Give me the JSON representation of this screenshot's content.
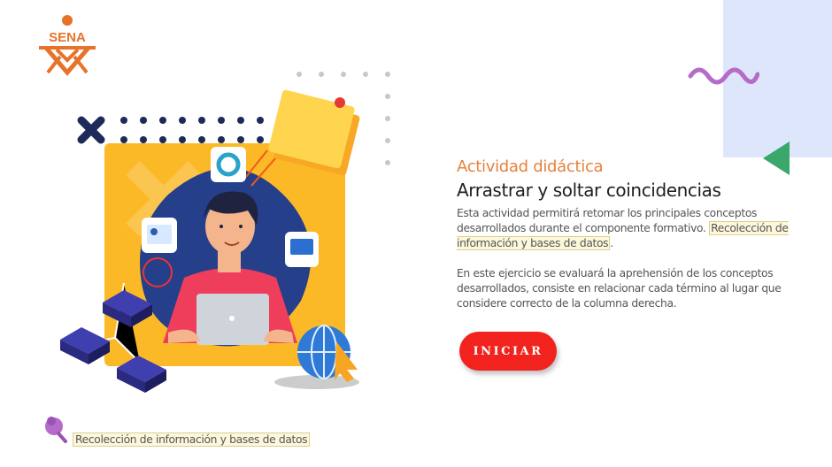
{
  "logo": {
    "text": "SENA",
    "color": "#e8722a"
  },
  "activity": {
    "kicker": "Actividad didáctica",
    "title": "Arrastrar y soltar coincidencias",
    "paragraph1_pre": "Esta actividad permitirá retomar los principales conceptos desarrollados durante el componente formativo.",
    "paragraph1_highlight": "Recolección de información y bases de datos",
    "paragraph1_post": ".",
    "paragraph2": "En este ejercicio se evaluará la aprehensión de los conceptos desarrollados, consiste en relacionar cada término al lugar que considere correcto de la columna derecha."
  },
  "start_button": {
    "label": "INICIAR",
    "color": "#f2231e"
  },
  "footer": {
    "label": "Recolección de información y bases de datos"
  },
  "colors": {
    "accent_orange": "#e8813a",
    "deco_blue": "#dde6fb",
    "deco_purple": "#b46cc8",
    "deco_green": "#3aa86b"
  },
  "icons": [
    "sena-logo",
    "wave-decoration",
    "triangle-decoration",
    "pin-icon",
    "person-laptop-illustration"
  ]
}
